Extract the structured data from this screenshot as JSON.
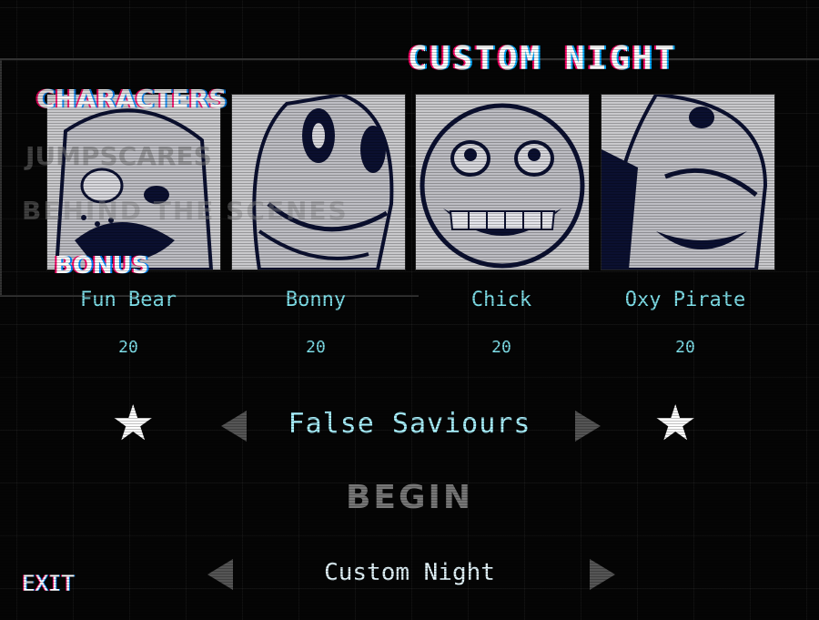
{
  "title": "CUSTOM NIGHT",
  "menu": {
    "characters": "CHARACTERS",
    "jumpscares": "JUMPSCARES",
    "behind_the_scenes": "BEHIND THE SCENES",
    "bonus": "BONUS"
  },
  "characters": [
    {
      "name": "Fun Bear",
      "level": "20"
    },
    {
      "name": "Bonny",
      "level": "20"
    },
    {
      "name": "Chick",
      "level": "20"
    },
    {
      "name": "Oxy Pirate",
      "level": "20"
    }
  ],
  "preset": {
    "label": "False Saviours",
    "star_glyph": "★"
  },
  "begin_label": "BEGIN",
  "exit_label": "EXIT",
  "mode_label": "Custom Night",
  "colors": {
    "accent_cyan": "#7fe0ea",
    "title_white": "#ffffff",
    "arrow_gray": "#555555",
    "portrait_bg": "#c9c9cc"
  }
}
